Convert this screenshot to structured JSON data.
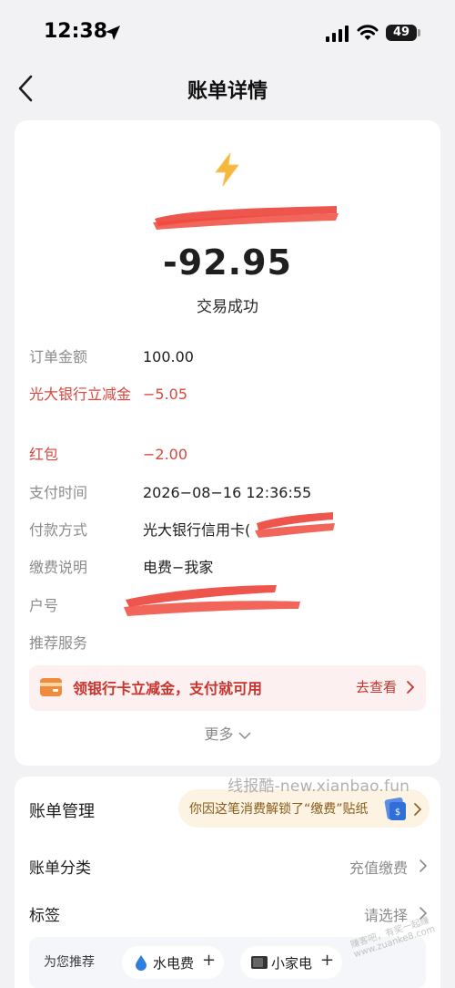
{
  "status_bar": {
    "time": "12:38",
    "battery": "49"
  },
  "header": {
    "title": "账单详情"
  },
  "transaction": {
    "amount": "-92.95",
    "status": "交易成功",
    "icon": "lightning-icon",
    "accent": "#f6b73c"
  },
  "details": [
    {
      "label": "订单金额",
      "value": "100.00"
    },
    {
      "label": "光大银行立减金",
      "value": "−5.05"
    },
    {
      "label": "红包",
      "value": "−2.00"
    },
    {
      "label": "支付时间",
      "value": "2026−08−16 12:36:55"
    },
    {
      "label": "付款方式",
      "value": "光大银行信用卡("
    },
    {
      "label": "缴费说明",
      "value": "电费−我家"
    },
    {
      "label": "户号",
      "value": ""
    },
    {
      "label": "推荐服务",
      "value": ""
    }
  ],
  "promo": {
    "text": "领银行卡立减金，支付就可用",
    "link": "去查看"
  },
  "more": "更多",
  "manage": {
    "title": "账单管理",
    "unlock_text": "你因这笔消费解锁了“缴费”贴纸",
    "rows": [
      {
        "label": "账单分类",
        "value": "充值缴费"
      },
      {
        "label": "标签",
        "value": "请选择"
      }
    ],
    "recommend_label": "为您推荐",
    "chips": [
      {
        "label": "水电费",
        "icon": "water-drop-icon"
      },
      {
        "label": "小家电",
        "icon": "appliance-icon"
      }
    ]
  },
  "colors": {
    "red": "#d9473f",
    "background": "#f2f2f4",
    "promo_bg": "#fdf0f0",
    "pill_bg": "#fcf3e3"
  },
  "watermark": "线报酷-new.xianbao.fun",
  "watermark_small": "赚客吧，有奖一起赚 www.zuanke8.com"
}
